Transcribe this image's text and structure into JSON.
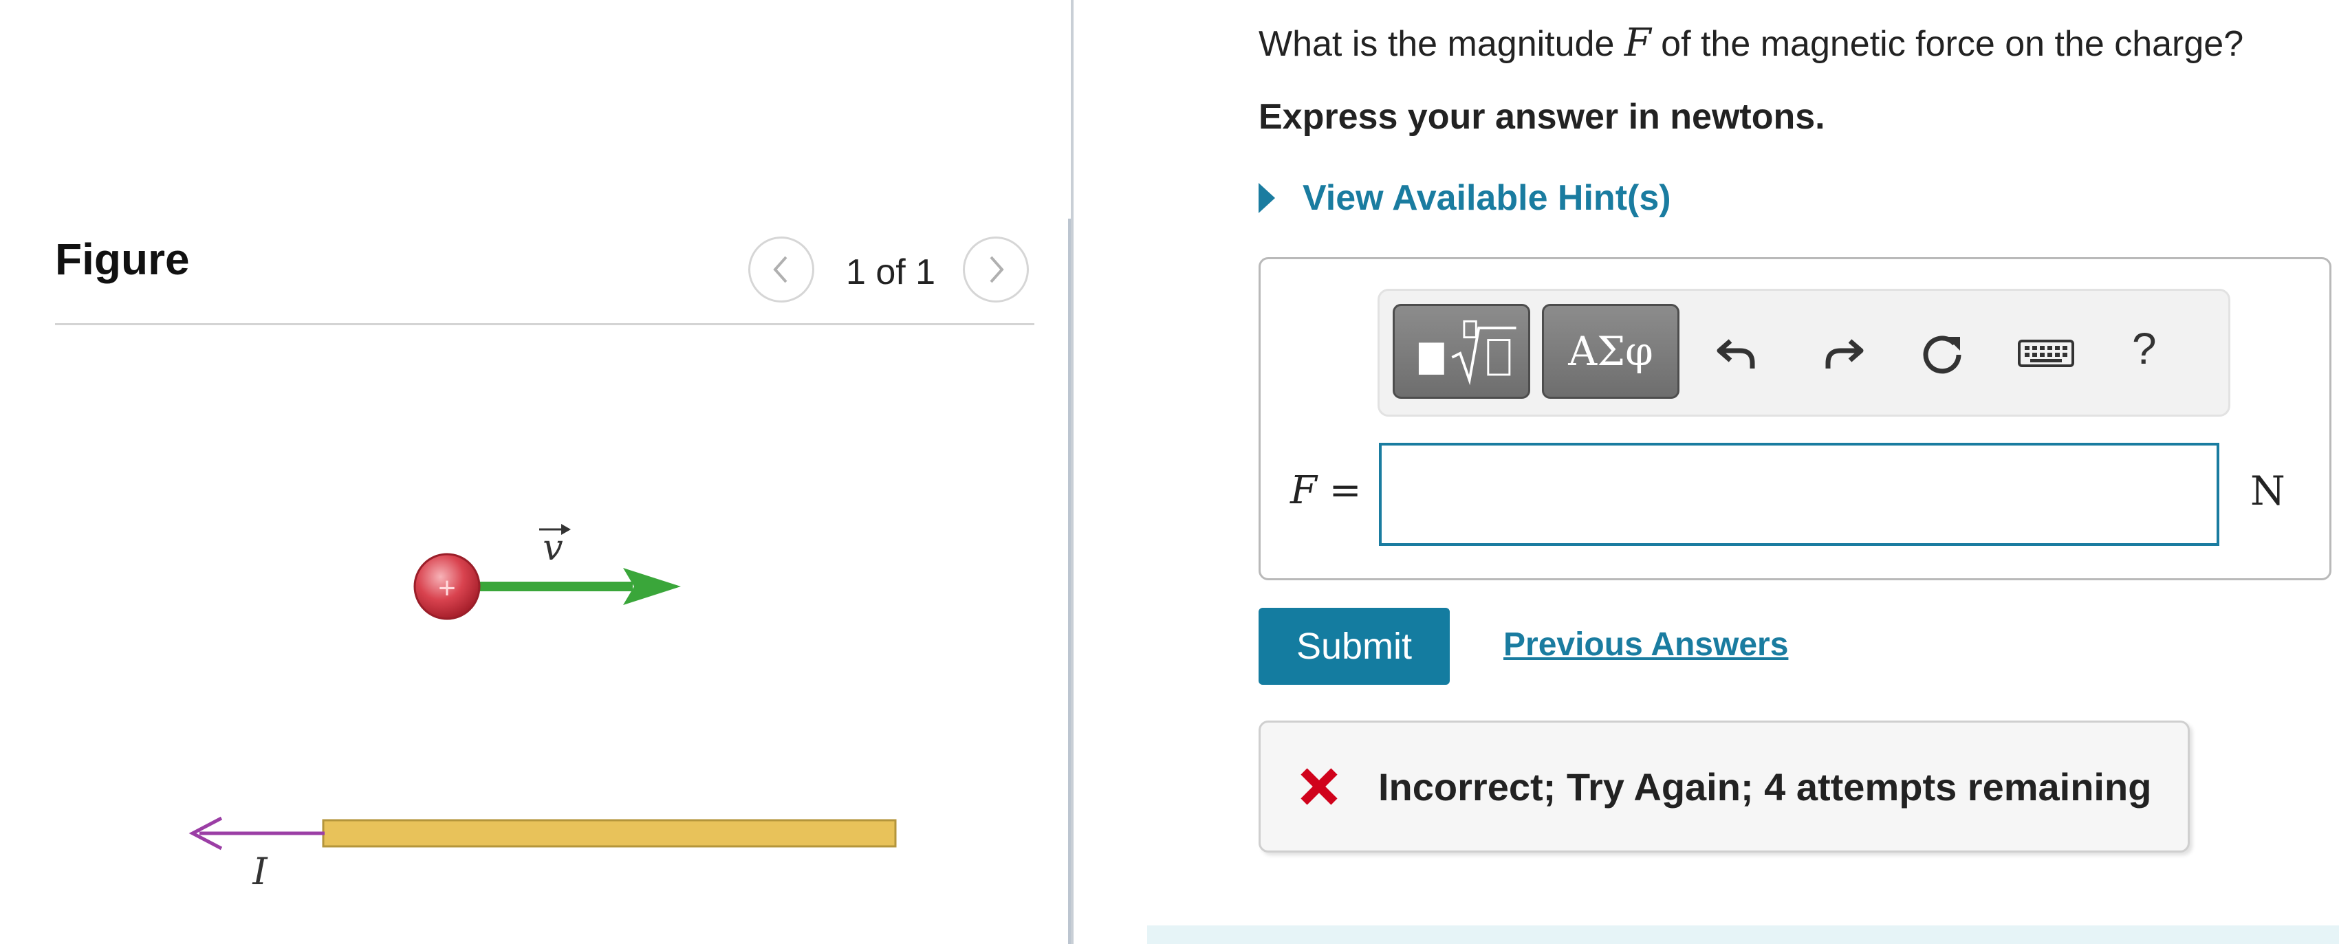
{
  "figure_panel": {
    "title": "Figure",
    "pager_text": "1 of 1",
    "prev_icon": "chevron-left-icon",
    "next_icon": "chevron-right-icon",
    "diagram": {
      "charge_symbol": "+",
      "velocity_label": "v",
      "current_label": "I",
      "colors": {
        "charge": "#d9434f",
        "velocity_arrow": "#3aa63a",
        "wire": "#e8c25a",
        "current_arrow": "#9b3ea5"
      }
    }
  },
  "question": {
    "prefix": "What is the magnitude",
    "variable": "F",
    "suffix": "of the magnetic force on the charge?",
    "instruction": "Express your answer in newtons.",
    "hint_link": "View Available Hint(s)"
  },
  "toolbar": {
    "template_icon": "template-sqrt-icon",
    "greek_label": "ΑΣφ",
    "undo_icon": "undo-icon",
    "redo_icon": "redo-icon",
    "reset_icon": "reset-icon",
    "keyboard_icon": "keyboard-icon",
    "help_label": "?"
  },
  "answer": {
    "label": "F =",
    "value": "",
    "unit": "N"
  },
  "actions": {
    "submit_label": "Submit",
    "previous_answers_label": "Previous Answers"
  },
  "feedback": {
    "icon": "x-icon",
    "text": "Incorrect; Try Again; 4 attempts remaining",
    "color": "#d0021b"
  },
  "accent_color": "#147ca0"
}
